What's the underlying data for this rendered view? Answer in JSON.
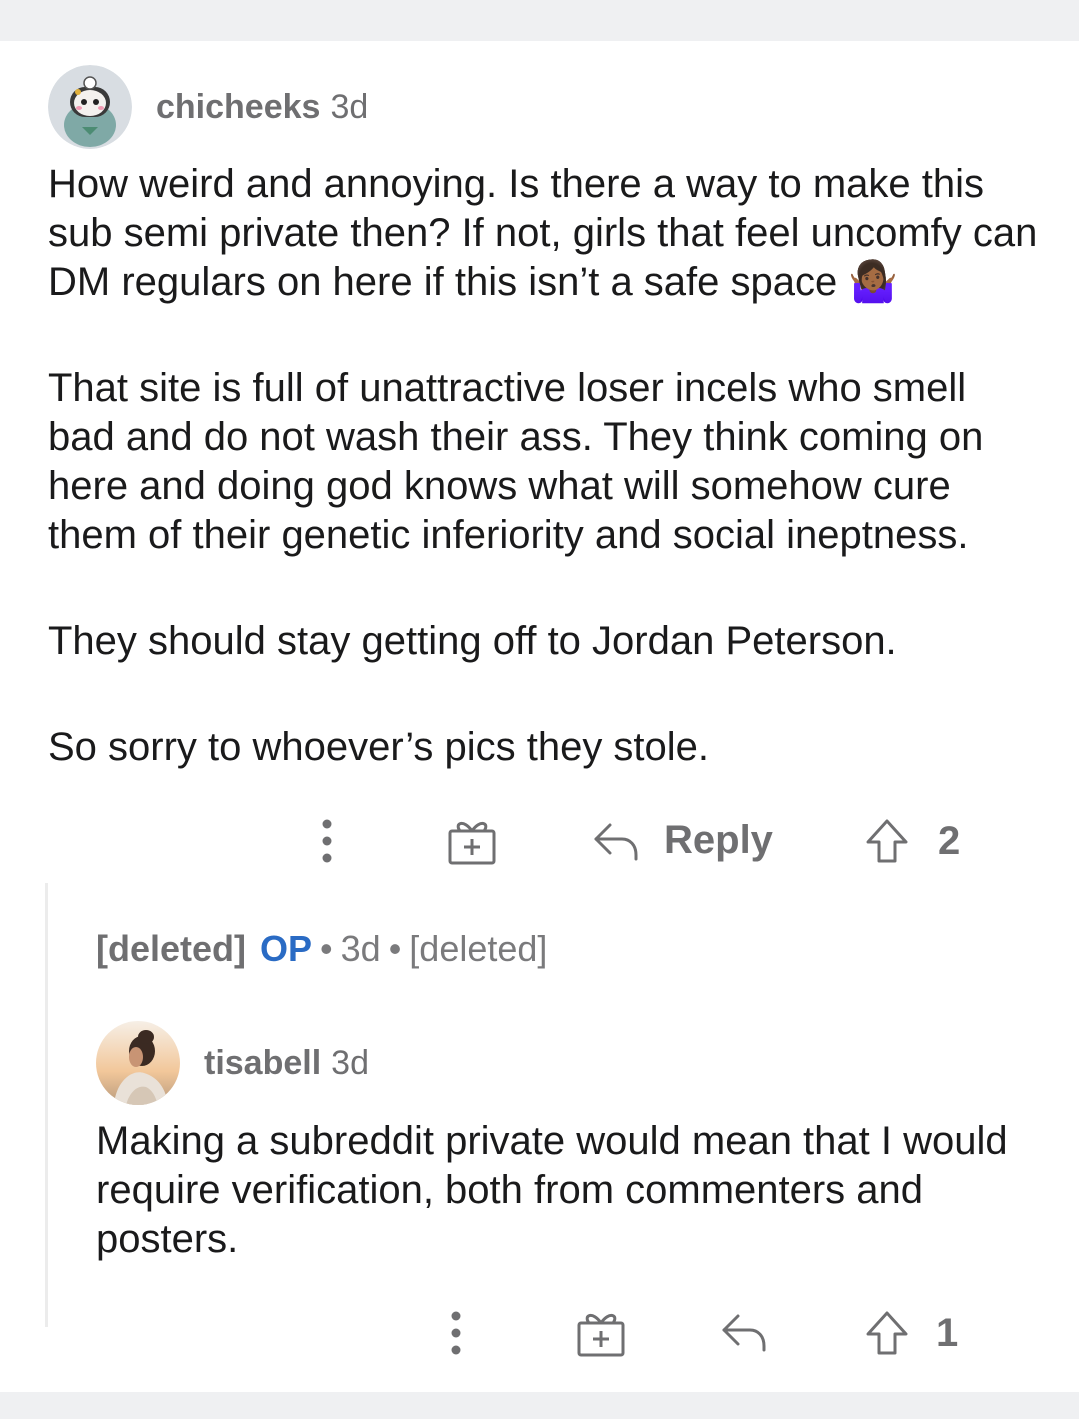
{
  "comment1": {
    "author": "chicheeks",
    "age": "3d",
    "paragraphs": [
      "How weird and annoying. Is there a way to make this sub semi private then? If not, girls that feel uncomfy can DM regulars on here  if this isn’t a safe space 🤷🏾‍♀️",
      "That site is full of unattractive loser incels who smell bad and do not wash their ass. They think coming on here and doing god knows what will somehow cure them of their genetic inferiority and social ineptness.",
      "They should stay getting off to Jordan Peterson.",
      "So sorry to whoever’s pics they stole."
    ],
    "reply_label": "Reply",
    "score": "2"
  },
  "deleted": {
    "author": "[deleted]",
    "op_badge": "OP",
    "separator": "•",
    "age": "3d",
    "body": "[deleted]"
  },
  "comment2": {
    "author": "tisabell",
    "age": "3d",
    "paragraphs": [
      "Making a subreddit private would mean that I would require verification, both from commenters and posters."
    ],
    "score": "1"
  },
  "icons": {
    "more": "more-vertical-icon",
    "award": "gift-award-icon",
    "reply": "reply-arrow-icon",
    "upvote": "upvote-arrow-icon"
  },
  "colors": {
    "op": "#2a6bc4",
    "meta": "#6f6f71",
    "text": "#1a1a1b",
    "background": "#eff0f2"
  }
}
